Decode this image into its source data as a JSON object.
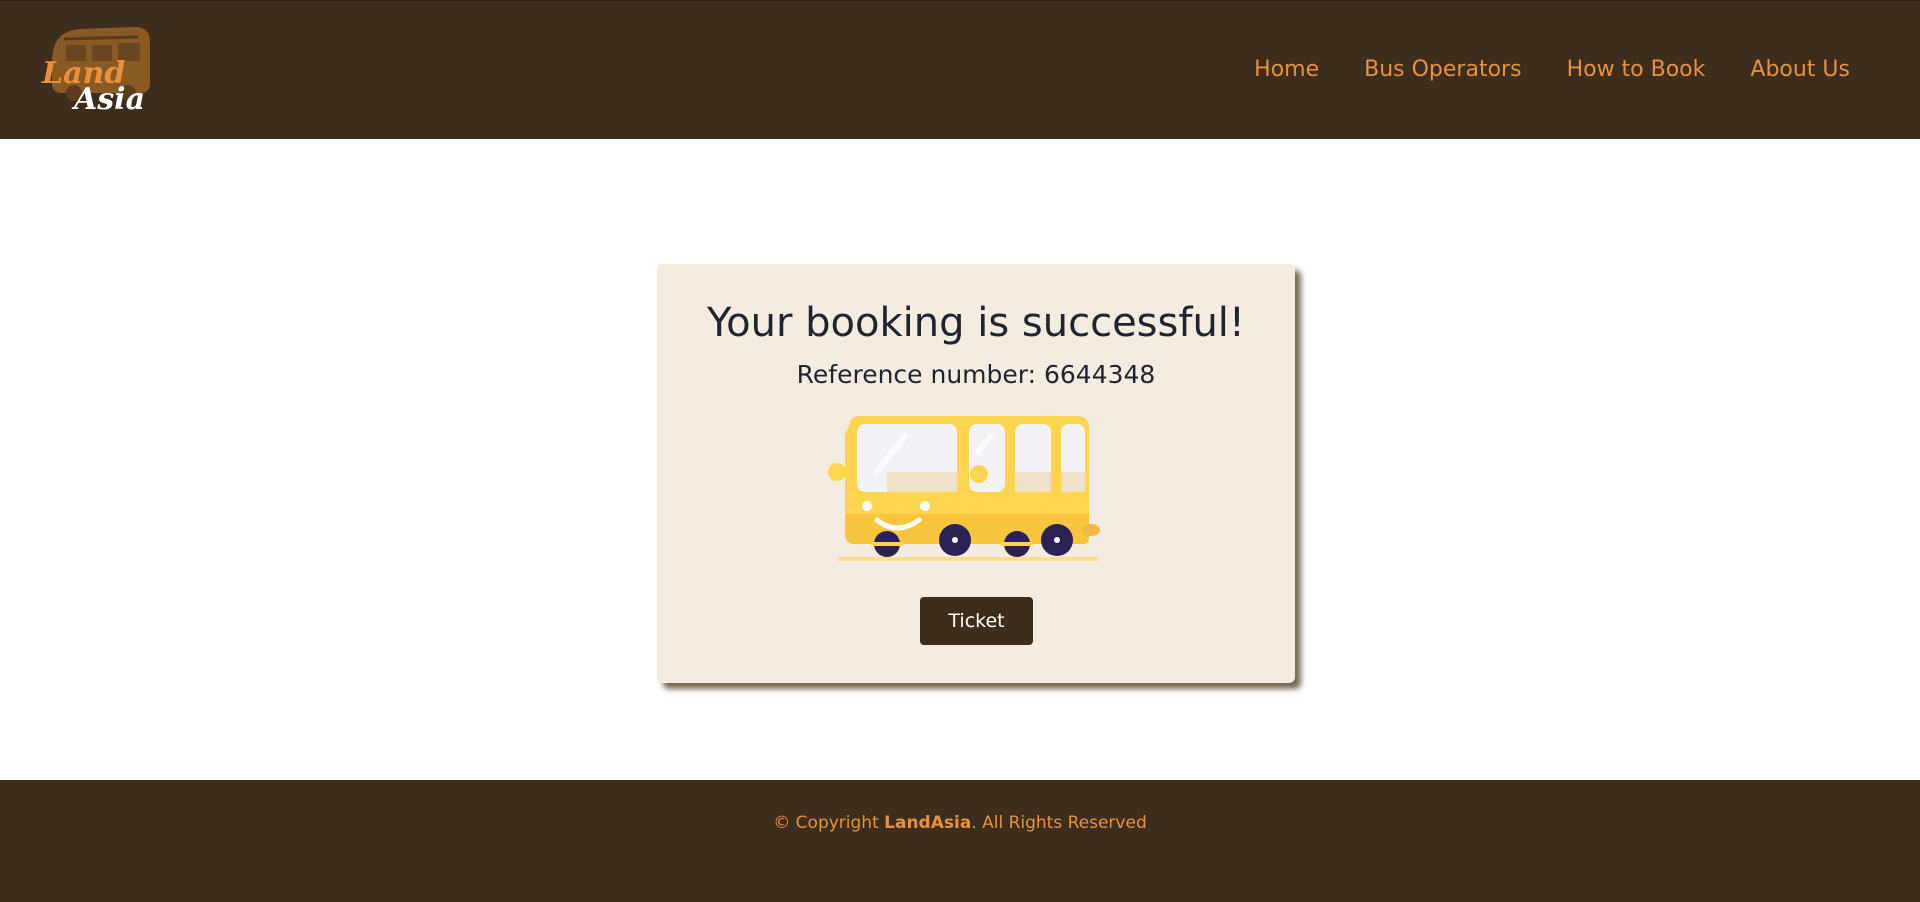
{
  "header": {
    "logo_text_top": "Land",
    "logo_text_bottom": "Asia",
    "nav": [
      {
        "label": "Home"
      },
      {
        "label": "Bus Operators"
      },
      {
        "label": "How to Book"
      },
      {
        "label": "About Us"
      }
    ]
  },
  "confirmation": {
    "title": "Your booking is successful!",
    "reference": "Reference number: 6644348",
    "button_label": "Ticket",
    "illustration": "bus-illustration"
  },
  "footer": {
    "prefix": "© Copyright ",
    "brand": "LandAsia",
    "suffix": ". All Rights Reserved"
  },
  "colors": {
    "nav_bg": "#3d2d1d",
    "accent": "#e8913a",
    "card_bg": "#f5ece1",
    "bus_yellow": "#ffd54f"
  }
}
